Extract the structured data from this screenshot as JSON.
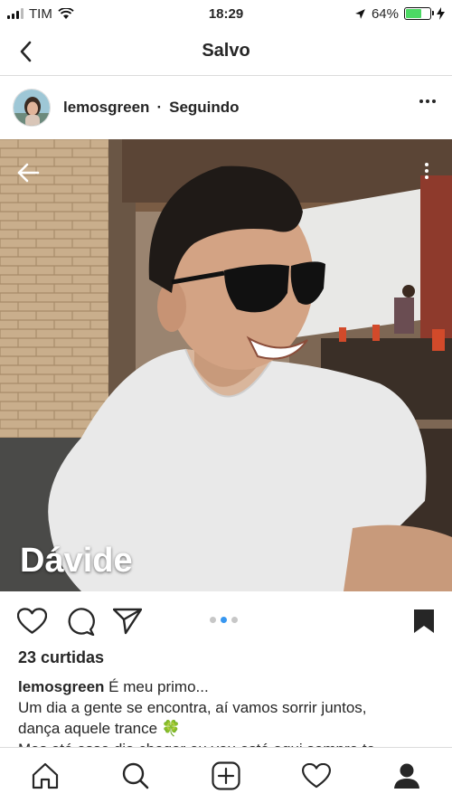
{
  "status_bar": {
    "carrier": "TIM",
    "time": "18:29",
    "battery_percent": "64%",
    "battery_level": 0.64
  },
  "nav": {
    "title": "Salvo"
  },
  "post": {
    "username": "lemosgreen",
    "separator": "·",
    "follow_status": "Seguindo",
    "photo_overlay_text": "Dávide",
    "carousel": {
      "count": 3,
      "active_index": 1
    },
    "likes": "23 curtidas",
    "caption_username": "lemosgreen",
    "caption_lines": [
      "É meu primo...",
      "Um dia a gente se encontra, aí vamos sorrir juntos,",
      "dança aquele trance",
      "Mas até esse dia chegar eu vou está aqui sempre te"
    ],
    "caption_emoji": "🍀"
  },
  "icons": {
    "back": "chevron-left-icon",
    "more": "more-horizontal-icon",
    "like": "heart-icon",
    "comment": "comment-icon",
    "share": "send-icon",
    "save": "bookmark-icon",
    "tabs": [
      "home-icon",
      "search-icon",
      "add-icon",
      "activity-icon",
      "profile-icon"
    ]
  },
  "colors": {
    "accent": "#3897f0",
    "battery": "#4cd964",
    "text": "#262626"
  }
}
